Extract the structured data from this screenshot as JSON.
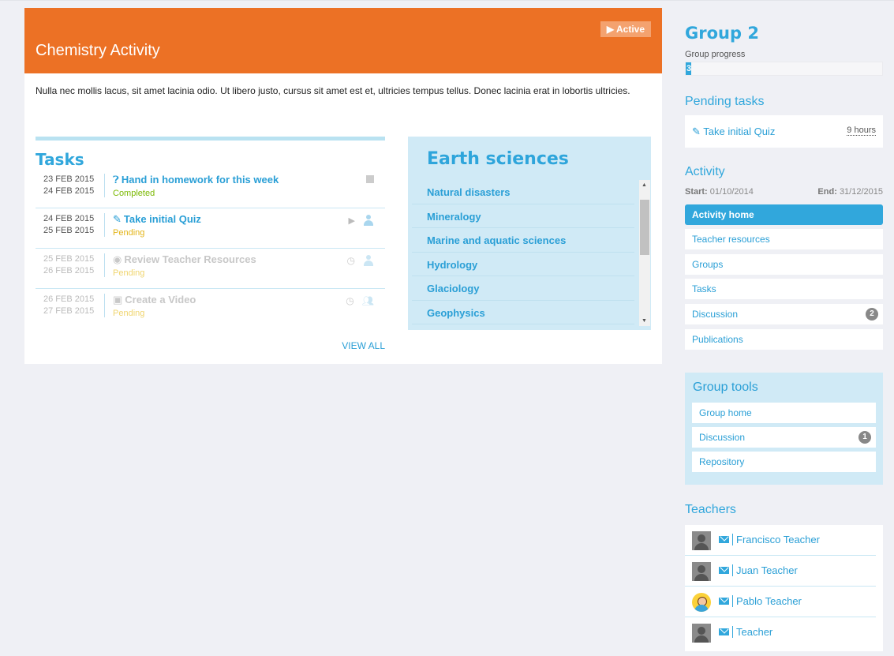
{
  "activity": {
    "title": "Chemistry Activity",
    "status_badge": "▶ Active",
    "description": "Nulla nec mollis lacus, sit amet lacinia odio. Ut libero justo, cursus sit amet est et, ultricies tempus tellus. Donec lacinia erat in lobortis ultricies."
  },
  "tasks": {
    "title": "Tasks",
    "view_all": "VIEW ALL",
    "items": [
      {
        "start": "23 FEB 2015",
        "end": "24 FEB 2015",
        "name": "Hand in homework for this week",
        "icon": "question-circle-icon",
        "status": "Completed"
      },
      {
        "start": "24 FEB 2015",
        "end": "25 FEB 2015",
        "name": "Take initial Quiz",
        "icon": "edit-icon",
        "status": "Pending"
      },
      {
        "start": "25 FEB 2015",
        "end": "26 FEB 2015",
        "name": "Review Teacher Resources",
        "icon": "eye-icon",
        "status": "Pending"
      },
      {
        "start": "26 FEB 2015",
        "end": "27 FEB 2015",
        "name": "Create a Video",
        "icon": "file-icon",
        "status": "Pending"
      }
    ]
  },
  "earth": {
    "title": "Earth sciences",
    "items": [
      "Natural disasters",
      "Mineralogy",
      "Marine and aquatic sciences",
      "Hydrology",
      "Glaciology",
      "Geophysics"
    ]
  },
  "group": {
    "title": "Group 2",
    "progress_label": "Group progress",
    "progress_value": "3",
    "progress_fraction": 0.03
  },
  "pending": {
    "title": "Pending tasks",
    "task": "Take initial Quiz",
    "time": "9 hours"
  },
  "activity_nav": {
    "title": "Activity",
    "start_label": "Start:",
    "start_date": "01/10/2014",
    "end_label": "End:",
    "end_date": "31/12/2015",
    "items": [
      {
        "label": "Activity home",
        "badge": ""
      },
      {
        "label": "Teacher resources",
        "badge": ""
      },
      {
        "label": "Groups",
        "badge": ""
      },
      {
        "label": "Tasks",
        "badge": ""
      },
      {
        "label": "Discussion",
        "badge": "2"
      },
      {
        "label": "Publications",
        "badge": ""
      }
    ]
  },
  "group_tools": {
    "title": "Group tools",
    "items": [
      {
        "label": "Group home",
        "badge": ""
      },
      {
        "label": "Discussion",
        "badge": "1"
      },
      {
        "label": "Repository",
        "badge": ""
      }
    ]
  },
  "teachers": {
    "title": "Teachers",
    "items": [
      "Francisco Teacher",
      "Juan Teacher",
      "Pablo Teacher",
      "Teacher"
    ]
  },
  "colors": {
    "orange_header": "#ec7125",
    "accent_blue": "#31a7dc",
    "light_blue_panel": "#d0eaf6",
    "completed_green": "#7ab800",
    "pending_yellow": "#e3b417"
  }
}
